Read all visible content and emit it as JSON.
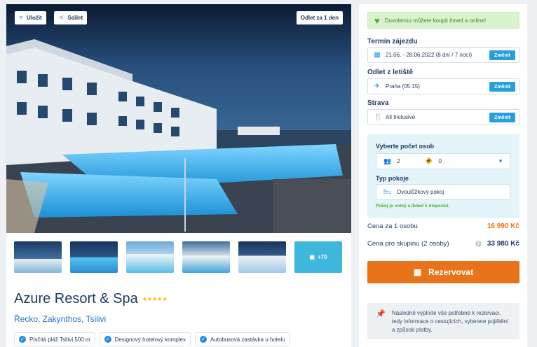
{
  "hero": {
    "save_label": "Uložit",
    "share_label": "Sdílet",
    "departure_badge": "Odlet za 1 den"
  },
  "thumbnails": {
    "more_label": "+70"
  },
  "hotel": {
    "name": "Azure Resort & Spa",
    "stars": "★★★★★",
    "location": "Řecko, Zakynthos, Tsilivi",
    "features": [
      "Písčitá pláž Tsilivi 500 m",
      "Designový hotelový komplex",
      "Autobusová zastávka u hotelu"
    ]
  },
  "booking": {
    "online_notice": "Dovolenou můžete koupit ihned a online!",
    "term_label": "Termín zájezdu",
    "term_value": "21.06. - 28.06.2022 (8 dní / 7 nocí)",
    "airport_label": "Odlet z letiště",
    "airport_value": "Praha (05:15)",
    "board_label": "Strava",
    "board_value": "All Inclusive",
    "change_label": "Změnit",
    "persons_label": "Vyberte počet osob",
    "adults": "2",
    "children": "0",
    "room_label": "Typ pokoje",
    "room_value": "Dvoulůžkový pokoj",
    "room_available": "Pokoj je volný a ihned k dispozici.",
    "price_per_person_label": "Cena za 1 osobu",
    "price_per_person": "16 990 Kč",
    "price_group_label": "Cena pro skupinu (2 osoby)",
    "price_group": "33 980 Kč",
    "reserve_label": "Rezervovat",
    "note": "Následně vyplníte vše potřebné k rezervaci, tedy informace o cestujících, vyberete pojištění a způsob platby."
  }
}
